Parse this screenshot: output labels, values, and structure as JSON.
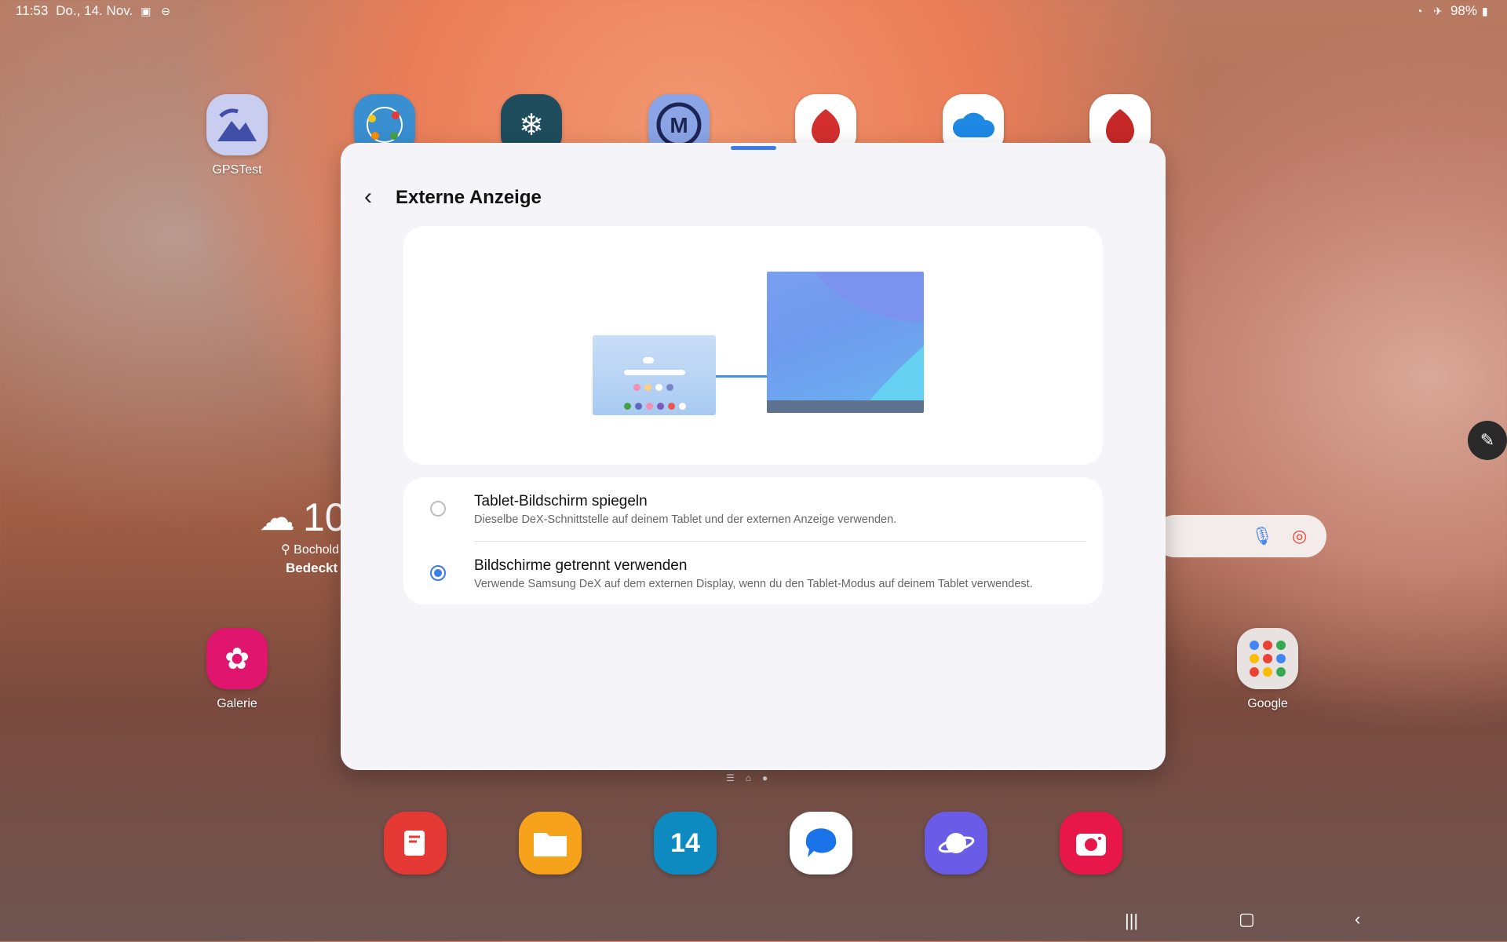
{
  "status": {
    "time": "11:53",
    "date": "Do., 14. Nov.",
    "battery": "98%"
  },
  "apps_top": [
    {
      "label": "GPSTest",
      "icon": "gps-mountain-icon",
      "color": "#c9cdef"
    },
    {
      "label": "",
      "icon": "network-globe-icon",
      "color": "#3a8fd0"
    },
    {
      "label": "",
      "icon": "snowflake-icon",
      "color": "#1f4d5e"
    },
    {
      "label": "",
      "icon": "m-circle-icon",
      "color": "#3d4a9c"
    },
    {
      "label": "",
      "icon": "antutu-icon",
      "color": "#ffffff"
    },
    {
      "label": "",
      "icon": "onedrive-cloud-icon",
      "color": "#ffffff"
    },
    {
      "label": "",
      "icon": "antutu-3d-icon",
      "color": "#ffffff"
    }
  ],
  "apps_left": {
    "label": "Galerie",
    "icon": "gallery-flower-icon",
    "color": "#e0156d"
  },
  "apps_right": {
    "label": "Google",
    "icon": "google-folder-icon",
    "color": "#e8e2e0"
  },
  "weather": {
    "temp": "10",
    "location": "Bochold",
    "condition": "Bedeckt"
  },
  "dialog": {
    "title": "Externe Anzeige",
    "options": [
      {
        "title": "Tablet-Bildschirm spiegeln",
        "desc": "Dieselbe DeX-Schnittstelle auf deinem Tablet und der externen Anzeige verwenden.",
        "selected": false
      },
      {
        "title": "Bildschirme getrennt verwenden",
        "desc": "Verwende Samsung DeX auf dem externen Display, wenn du den Tablet-Modus auf deinem Tablet verwendest.",
        "selected": true
      }
    ]
  },
  "dock": [
    {
      "icon": "notes-icon",
      "color": "#e53935"
    },
    {
      "icon": "folder-icon",
      "color": "#f6a21a"
    },
    {
      "icon": "calendar-icon",
      "color": "#0d8bc0",
      "text": "14"
    },
    {
      "icon": "messages-icon",
      "color": "#ffffff"
    },
    {
      "icon": "internet-planet-icon",
      "color": "#6b5ce7"
    },
    {
      "icon": "camera-icon",
      "color": "#e8174a"
    }
  ]
}
